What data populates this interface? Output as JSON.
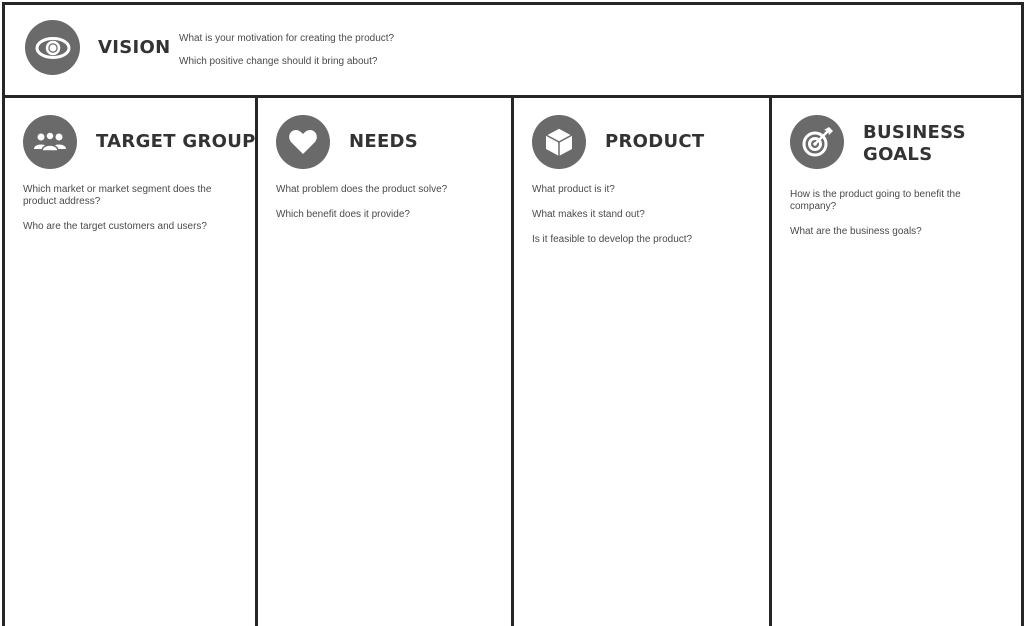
{
  "vision": {
    "title": "VISION",
    "icon": "eye-icon",
    "questions": [
      "What is your motivation for creating the product?",
      "Which positive change should it bring about?"
    ]
  },
  "columns": [
    {
      "title": "TARGET  GROUP",
      "icon": "people-icon",
      "questions": [
        "Which market or market segment does the product address?",
        "Who are the target customers and users?"
      ]
    },
    {
      "title": "NEEDS",
      "icon": "heart-icon",
      "questions": [
        "What problem does the product solve?",
        "Which benefit does it provide?"
      ]
    },
    {
      "title": "PRODUCT",
      "icon": "box-icon",
      "questions": [
        "What product is it?",
        "What makes it stand out?",
        "Is it feasible to develop the product?"
      ]
    },
    {
      "title": "BUSINESS\nGOALS",
      "icon": "target-icon",
      "questions": [
        "How is the product going to benefit the company?",
        "What are the business goals?"
      ]
    }
  ],
  "colors": {
    "border": "#262626",
    "icon_circle": "#6a6a6a",
    "text": "#333333"
  }
}
